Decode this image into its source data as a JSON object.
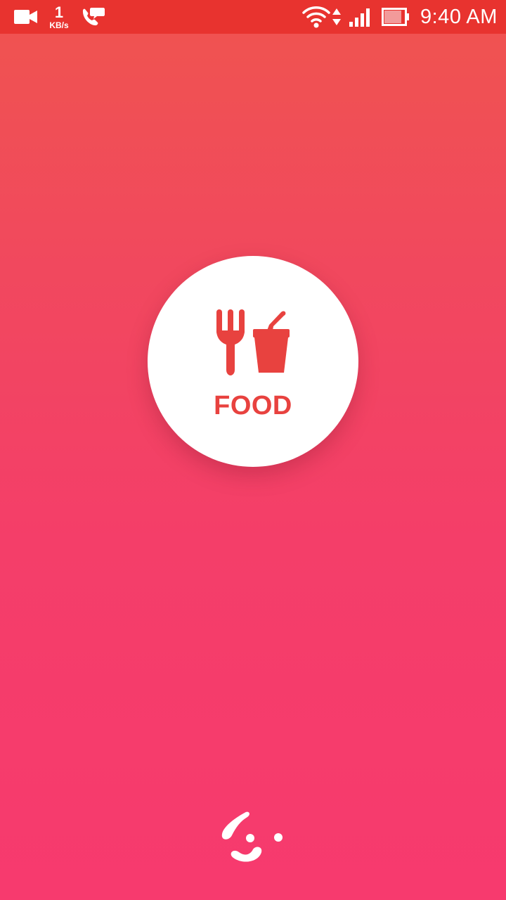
{
  "status_bar": {
    "network_speed_value": "1",
    "network_speed_unit": "KB/s",
    "time": "9:40 AM",
    "icons": [
      "video-camera-icon",
      "call-message-icon",
      "wifi-icon",
      "data-transfer-icon",
      "cellular-signal-icon",
      "battery-icon"
    ]
  },
  "main": {
    "category_label": "FOOD",
    "category_icon": "fork-and-drink-icon"
  },
  "brand": {
    "logo_icon": "brand-logo-icon"
  },
  "colors": {
    "status_bar": "#e8332f",
    "gradient_top": "#f0544f",
    "gradient_bottom": "#f73a6e",
    "accent": "#e8423f",
    "badge": "#ffffff"
  }
}
